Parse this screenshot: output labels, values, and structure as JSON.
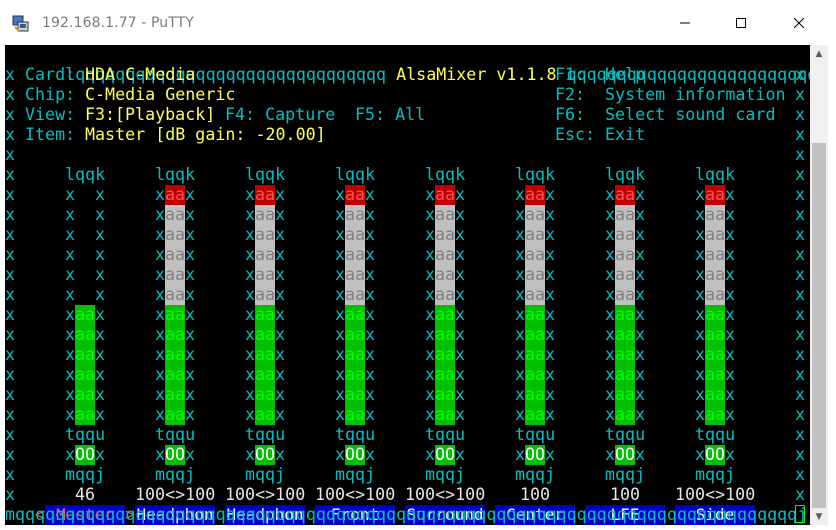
{
  "window": {
    "title": "192.168.1.77 - PuTTY",
    "icon": "putty-icon"
  },
  "alsamixer": {
    "header_left": "lqqqqqqqqqqqqqqqqqqqqqqqqqqqqqqq",
    "header_title": "AlsaMixer v1.1.8",
    "header_right": "qqqqqqqqqqqqqqqqqqqqqqqqqqqqqqqqk",
    "card_label": "Card:",
    "card_value": "HDA C-Media",
    "chip_label": "Chip:",
    "chip_value": "C-Media Generic",
    "view_label": "View:",
    "view_f3": "F3:",
    "view_playback": "[Playback]",
    "view_f4": "F4: Capture",
    "view_f5": "F5: All",
    "item_label": "Item:",
    "item_value": "Master [dB gain: -20.00]",
    "help": [
      {
        "key": "F1:",
        "label": "Help"
      },
      {
        "key": "F2:",
        "label": "System information"
      },
      {
        "key": "F6:",
        "label": "Select sound card"
      },
      {
        "key": "Esc:",
        "label": "Exit"
      }
    ],
    "footer_line": "mqqqqqqqqqqqqqqqqqqqqqqqqqqqqqqqqqqqqqqqqqqqqqqqqqqqqqqqqqqqqqqqqqqqqqqqqqqqqqqj",
    "channels": [
      {
        "name": "Master",
        "level": "46",
        "level_fraction": 0.46,
        "selected": true,
        "stereo": false,
        "switch": "OO"
      },
      {
        "name": "Headphon",
        "level": "100<>100",
        "level_fraction": 1.0,
        "selected": false,
        "stereo": true,
        "switch": "OO"
      },
      {
        "name": "Headphon",
        "level": "100<>100",
        "level_fraction": 1.0,
        "selected": false,
        "stereo": true,
        "switch": "OO"
      },
      {
        "name": "Front",
        "level": "100<>100",
        "level_fraction": 1.0,
        "selected": false,
        "stereo": true,
        "switch": "OO"
      },
      {
        "name": "Surround",
        "level": "100<>100",
        "level_fraction": 1.0,
        "selected": false,
        "stereo": true,
        "switch": "OO"
      },
      {
        "name": "Center",
        "level": "100",
        "level_fraction": 1.0,
        "selected": false,
        "stereo": false,
        "switch": "OO"
      },
      {
        "name": "LFE",
        "level": "100",
        "level_fraction": 1.0,
        "selected": false,
        "stereo": false,
        "switch": "OO"
      },
      {
        "name": "Side",
        "level": "100<>100",
        "level_fraction": 1.0,
        "selected": false,
        "stereo": true,
        "switch": "OO"
      }
    ],
    "bar_top": "lqqk",
    "bar_side": "x",
    "bar_switch_top": "tqqu",
    "bar_switch_bottom": "mqqj",
    "bar_fill_chars": "aa",
    "selector_left": "<",
    "selector_right": ">"
  },
  "colors": {
    "border": "#00c0c0",
    "highlight": "#ffff55",
    "green": "#00c000",
    "red": "#c00000",
    "white": "#c0c0c0",
    "tab_bg": "#0000cc",
    "selected_tab_text": "#ff5555"
  }
}
